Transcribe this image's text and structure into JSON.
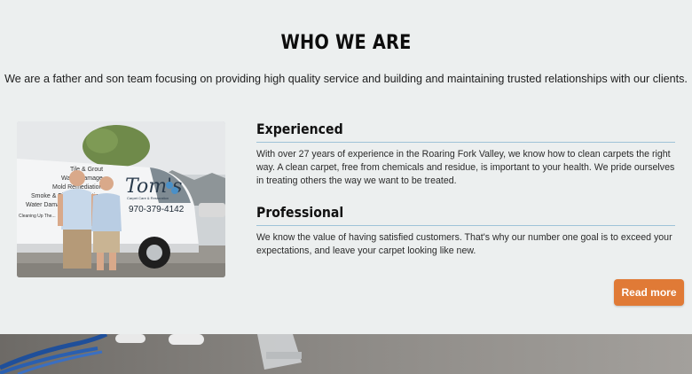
{
  "about": {
    "heading": "WHO WE ARE",
    "intro": "We are a father and son team focusing on providing high quality service and building and maintaining trusted relationships with our clients.",
    "sections": [
      {
        "title": "Experienced",
        "body": "With over 27 years of experience in the Roaring Fork Valley, we know how to clean carpets the right way. A clean carpet, free from chemicals and residue, is important to your health. We pride ourselves in treating others the way we want to be treated."
      },
      {
        "title": "Professional",
        "body": "We know the value of having satisfied customers. That's why our number one goal is to exceed your expectations, and leave your carpet looking like new."
      }
    ],
    "read_more_label": "Read more",
    "photo": {
      "van_brand": "Tom's",
      "van_tagline": "Carpet Care & Restoration",
      "van_phone": "970-379-4142",
      "van_services": [
        "Tile & Grout",
        "Water Damage",
        "Mold Remediation",
        "Smoke & Fire Restoration",
        "Water Damage",
        "Cleaning Up The..."
      ]
    }
  },
  "colors": {
    "background": "#ecefef",
    "accent": "#e07a36",
    "rule": "#9ec3d8"
  }
}
